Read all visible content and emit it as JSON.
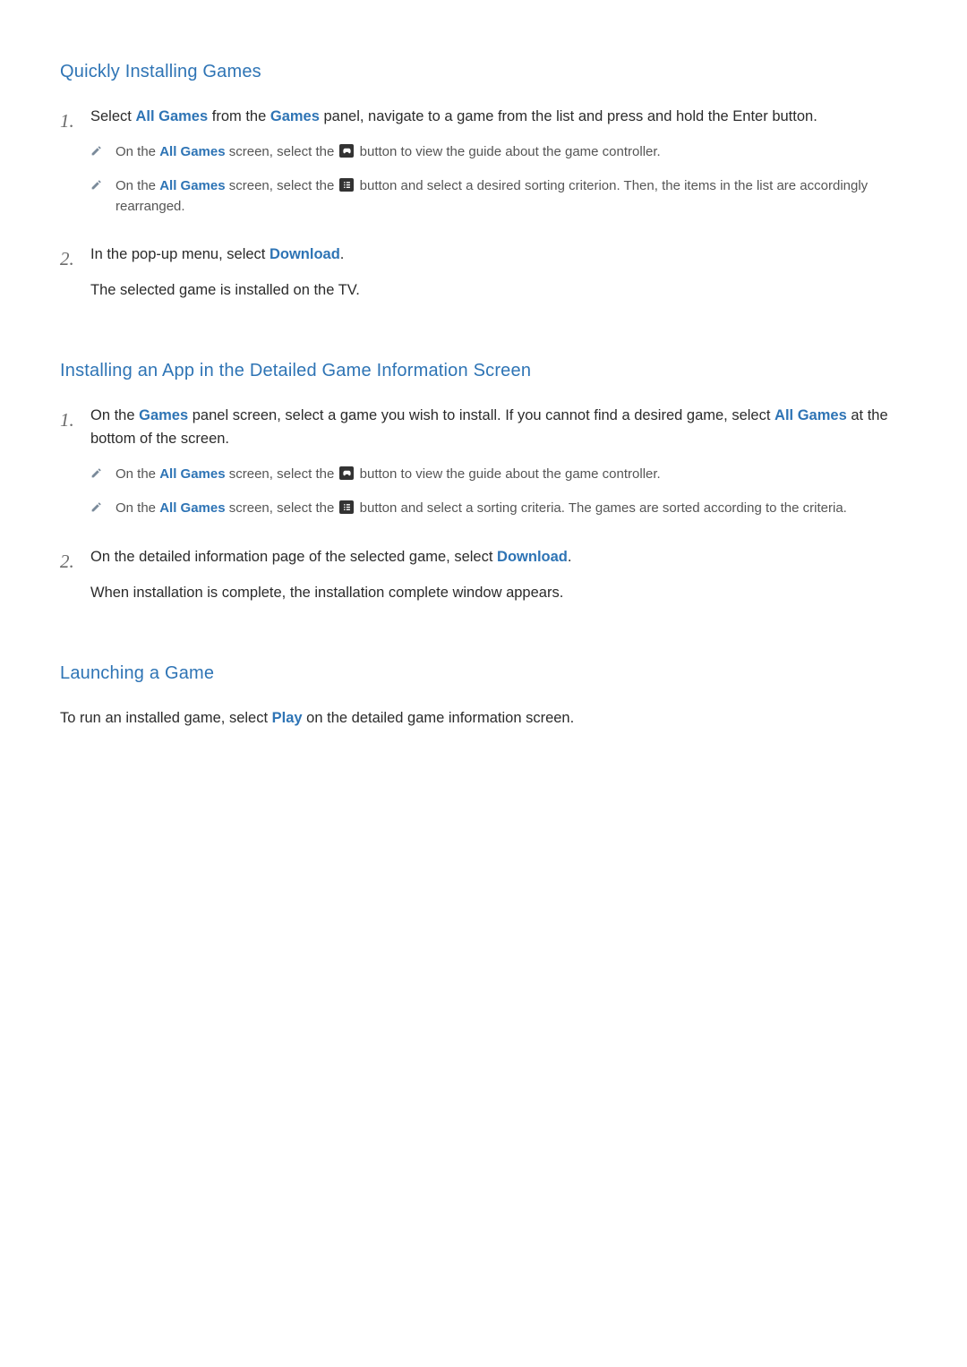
{
  "sec1": {
    "heading": "Quickly Installing Games",
    "step1": {
      "num": "1.",
      "t0": "Select ",
      "hl0": "All Games",
      "t1": " from the ",
      "hl1": "Games",
      "t2": " panel, navigate to a game from the list and press and hold the Enter button.",
      "note1": {
        "t0": "On the ",
        "hl0": "All Games",
        "t1": " screen, select the ",
        "t2": " button to view the guide about the game controller."
      },
      "note2": {
        "t0": "On the ",
        "hl0": "All Games",
        "t1": " screen, select the ",
        "t2": " button and select a desired sorting criterion. Then, the items in the list are accordingly rearranged."
      }
    },
    "step2": {
      "num": "2.",
      "t0": "In the pop-up menu, select ",
      "hl0": "Download",
      "t1": ".",
      "result": "The selected game is installed on the TV."
    }
  },
  "sec2": {
    "heading": "Installing an App in the Detailed Game Information Screen",
    "step1": {
      "num": "1.",
      "t0": "On the ",
      "hl0": "Games",
      "t1": " panel screen, select a game you wish to install. If you cannot find a desired game, select ",
      "hl1": "All Games",
      "t2": " at the bottom of the screen.",
      "note1": {
        "t0": "On the ",
        "hl0": "All Games",
        "t1": " screen, select the ",
        "t2": " button to view the guide about the game controller."
      },
      "note2": {
        "t0": "On the ",
        "hl0": "All Games",
        "t1": " screen, select the ",
        "t2": " button and select a sorting criteria. The games are sorted according to the criteria."
      }
    },
    "step2": {
      "num": "2.",
      "t0": "On the detailed information page of the selected game, select ",
      "hl0": "Download",
      "t1": ".",
      "result": "When installation is complete, the installation complete window appears."
    }
  },
  "sec3": {
    "heading": "Launching a Game",
    "p0": "To run an installed game, select ",
    "hl0": "Play",
    "p1": " on the detailed game information screen."
  }
}
